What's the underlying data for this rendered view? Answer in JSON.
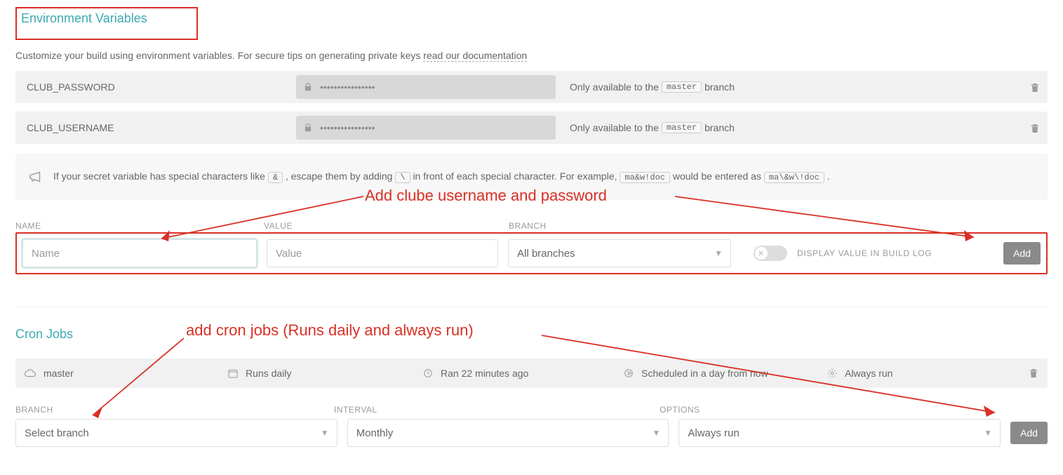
{
  "env": {
    "title": "Environment Variables",
    "desc_prefix": "Customize your build using environment variables. For secure tips on generating private keys ",
    "desc_link": "read our documentation",
    "vars": [
      {
        "name": "CLUB_PASSWORD",
        "value": "••••••••••••••••",
        "branch_prefix": "Only available to the ",
        "branch": "master",
        "branch_suffix": " branch"
      },
      {
        "name": "CLUB_USERNAME",
        "value": "••••••••••••••••",
        "branch_prefix": "Only available to the ",
        "branch": "master",
        "branch_suffix": " branch"
      }
    ],
    "info_parts": {
      "p1": "If your secret variable has special characters like ",
      "amp": "&",
      "p2": ", escape them by adding ",
      "bs": "\\",
      "p3": " in front of each special character. For example, ",
      "ex1": "ma&w!doc",
      "p4": " would be entered as ",
      "ex2": "ma\\&w\\!doc",
      "p5": " ."
    },
    "labels": {
      "name": "NAME",
      "value": "VALUE",
      "branch": "BRANCH"
    },
    "inputs": {
      "name_ph": "Name",
      "value_ph": "Value",
      "branch_ph": "All branches"
    },
    "toggle_label": "DISPLAY VALUE IN BUILD LOG",
    "add_button": "Add"
  },
  "anno": {
    "env_text": "Add clube username and password",
    "cron_text": "add cron jobs (Runs daily and always run)"
  },
  "cron": {
    "title": "Cron Jobs",
    "row": {
      "branch": "master",
      "interval": "Runs daily",
      "last_run": "Ran 22 minutes ago",
      "next_run": "Scheduled in a day from now",
      "option": "Always run"
    },
    "labels": {
      "branch": "BRANCH",
      "interval": "INTERVAL",
      "options": "OPTIONS"
    },
    "inputs": {
      "branch_ph": "Select branch",
      "interval_value": "Monthly",
      "options_value": "Always run"
    },
    "add_button": "Add"
  }
}
